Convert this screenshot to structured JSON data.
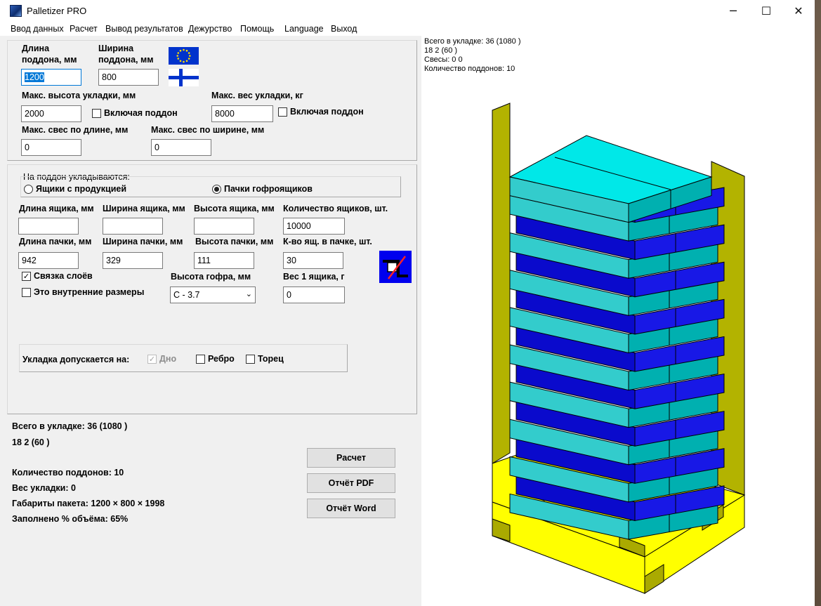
{
  "window": {
    "title": "Palletizer PRO",
    "minimize_symbol": "─",
    "maximize_symbol": "☐",
    "close_symbol": "✕"
  },
  "menu": [
    "Ввод данных",
    "Расчет",
    "Вывод результатов",
    "Дежурство",
    "Помощь",
    "Language",
    "Выход"
  ],
  "pallet": {
    "length_label": "Длина поддона, мм",
    "length_value": "1200",
    "width_label": "Ширина поддона, мм",
    "width_value": "800",
    "max_height_label": "Макс. высота укладки, мм",
    "max_height_value": "2000",
    "include_pallet_height_label": "Включая поддон",
    "max_weight_label": "Макс. вес укладки, кг",
    "max_weight_value": "8000",
    "include_pallet_weight_label": "Включая поддон",
    "max_overhang_length_label": "Макс. свес по длине, мм",
    "max_overhang_length_value": "0",
    "max_overhang_width_label": "Макс. свес по ширине, мм",
    "max_overhang_width_value": "0"
  },
  "load": {
    "group_label": "На поддон укладываются:",
    "option_boxes": "Ящики с продукцией",
    "option_bundles": "Пачки гофроящиков",
    "selected": "bundles",
    "box_length_label": "Длина ящика, мм",
    "box_length_value": "",
    "box_width_label": "Ширина ящика, мм",
    "box_width_value": "",
    "box_height_label": "Высота ящика, мм",
    "box_height_value": "",
    "box_count_label": "Количество ящиков, шт.",
    "box_count_value": "10000",
    "bundle_length_label": "Длина пачки, мм",
    "bundle_length_value": "942",
    "bundle_width_label": "Ширина пачки, мм",
    "bundle_width_value": "329",
    "bundle_height_label": "Высота пачки, мм",
    "bundle_height_value": "111",
    "boxes_per_bundle_label": "К-во ящ. в пачке, шт.",
    "boxes_per_bundle_value": "30",
    "layer_tie_label": "Связка слоёв",
    "layer_tie_checked": true,
    "inner_dims_label": "Это внутренние размеры",
    "inner_dims_checked": false,
    "flute_height_label": "Высота гофра, мм",
    "flute_height_value": "C - 3.7",
    "box_weight_label": "Вес 1 ящика, г",
    "box_weight_value": "0",
    "orientation_label": "Укладка допускается на:",
    "orient_bottom_label": "Дно",
    "orient_edge_label": "Ребро",
    "orient_end_label": "Торец"
  },
  "results": {
    "total_line": "Всего в укладке: 36  (1080 )",
    "layers_line": "18  2  (60 )",
    "pallets_line": "Количество поддонов: 10",
    "weight_line": "Вес укладки: 0",
    "dims_line": "Габариты пакета: 1200 × 800 × 1998",
    "fill_line": "Заполнено % объёма:  65%"
  },
  "buttons": {
    "calc": "Расчет",
    "pdf": "Отчёт PDF",
    "word": "Отчёт Word"
  },
  "preview": {
    "total_line": "Всего в укладке: 36  (1080 )",
    "layers_line": "18  2  (60 )",
    "overhang_line": "Свесы: 0  0",
    "pallets_line": "Количество поддонов: 10",
    "layer_count": 18,
    "colors": {
      "navy": "#0a0acc",
      "navy_side": "#1818e6",
      "teal_top": "#00e8e8",
      "teal_side": "#00b0b0",
      "teal_front": "#33cccc",
      "pallet": "#ffff00",
      "pallet_dark": "#aaaa00",
      "wall": "#b3b300"
    }
  }
}
